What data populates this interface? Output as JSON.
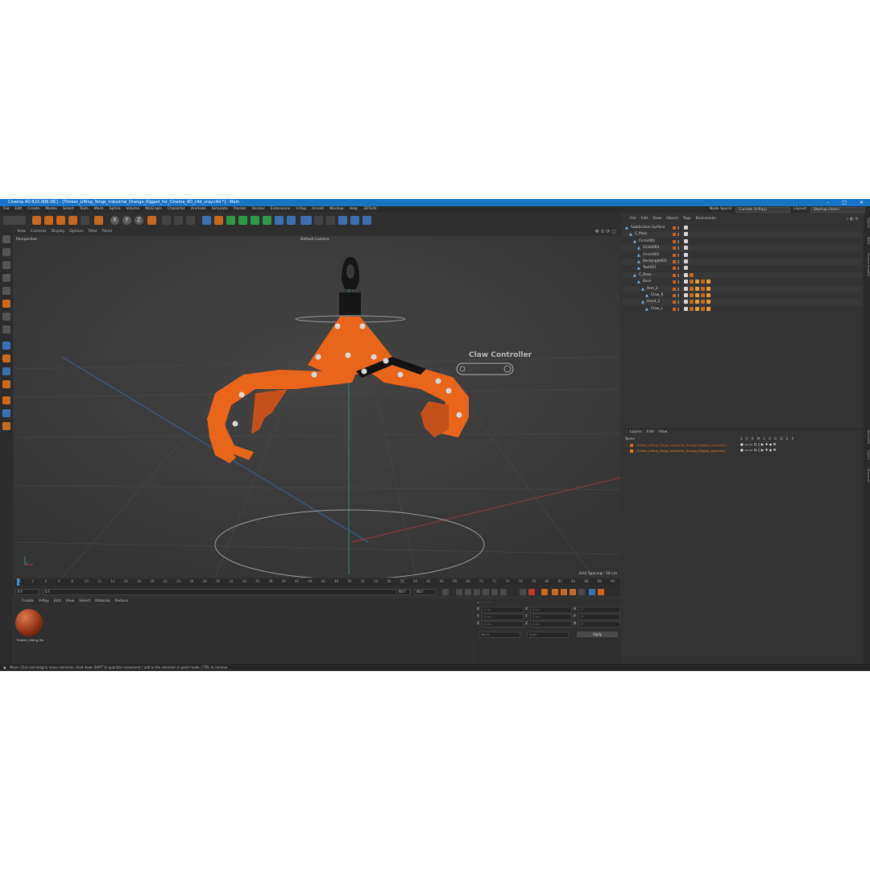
{
  "window": {
    "title": "Cinema 4D R23.008 (RC) - [Timber_Lifting_Tongs_Industrial_Orange_Rigged_for_Cinema_4D_c4d_vray.c4d *] - Main",
    "buttons": [
      "–",
      "□",
      "✕"
    ]
  },
  "menubar": {
    "items": [
      "File",
      "Edit",
      "Create",
      "Modes",
      "Select",
      "Tools",
      "Mesh",
      "Spline",
      "Volume",
      "MoGraph",
      "Character",
      "Animate",
      "Simulate",
      "Tracker",
      "Render",
      "Extensions",
      "V-Ray",
      "Arnold",
      "Window",
      "Help",
      "3DToAll"
    ],
    "node_space_label": "Node Space:",
    "node_space_value": "Current (V-Ray)",
    "layout_label": "Layout:",
    "layout_value": "Startup (User)"
  },
  "viewport": {
    "menu": [
      "View",
      "Cameras",
      "Display",
      "Options",
      "Filter",
      "Panel"
    ],
    "view_name": "Perspective",
    "camera": "Default Camera",
    "controller_label": "Claw Controller",
    "grid_spacing": "Grid Spacing : 50 cm"
  },
  "timeline": {
    "ticks": [
      "0",
      "2",
      "4",
      "6",
      "8",
      "10",
      "12",
      "14",
      "16",
      "18",
      "20",
      "22",
      "24",
      "26",
      "28",
      "30",
      "32",
      "34",
      "36",
      "38",
      "40",
      "42",
      "44",
      "46",
      "48",
      "50",
      "52",
      "54",
      "56",
      "58",
      "60",
      "62",
      "64",
      "66",
      "68",
      "70",
      "72",
      "74",
      "76",
      "78",
      "80",
      "82",
      "84",
      "86",
      "88",
      "90"
    ],
    "current_frame_field": "0 F",
    "start_field": "0 F",
    "end_field": "90 F",
    "end_field2": "90 F",
    "frame_display": "0 F"
  },
  "material_panel": {
    "menu": [
      "Create",
      "V-Ray",
      "Edit",
      "View",
      "Select",
      "Material",
      "Texture"
    ],
    "material_name": "Timber_Lifting_Ro"
  },
  "coordinates": {
    "rows": [
      {
        "axis": "X",
        "pos": "0 cm",
        "axis2": "X",
        "size": "0 cm",
        "axis3": "H",
        "rot": "0°"
      },
      {
        "axis": "Y",
        "pos": "0 cm",
        "axis2": "Y",
        "size": "0 cm",
        "axis3": "P",
        "rot": "0°"
      },
      {
        "axis": "Z",
        "pos": "0 cm",
        "axis2": "Z",
        "size": "0 cm",
        "axis3": "B",
        "rot": "0°"
      }
    ],
    "mode1": "World",
    "mode2": "Scale",
    "apply": "Apply"
  },
  "object_manager": {
    "menu": [
      "File",
      "Edit",
      "View",
      "Object",
      "Tags",
      "Bookmarks"
    ],
    "objects": [
      {
        "name": "Subdivision Surface",
        "indent": 0
      },
      {
        "name": "C_Main",
        "indent": 1
      },
      {
        "name": "Circle001",
        "indent": 2
      },
      {
        "name": "Circle003",
        "indent": 3
      },
      {
        "name": "Circle002",
        "indent": 3
      },
      {
        "name": "Rectangle001",
        "indent": 3
      },
      {
        "name": "Text001",
        "indent": 3
      },
      {
        "name": "C_Base",
        "indent": 2
      },
      {
        "name": "Base",
        "indent": 3
      },
      {
        "name": "Arm_2",
        "indent": 4
      },
      {
        "name": "Claw_R",
        "indent": 5
      },
      {
        "name": "Hand_1",
        "indent": 4
      },
      {
        "name": "Claw_L",
        "indent": 5
      }
    ]
  },
  "layer_manager": {
    "menu": [
      "Layers",
      "Edit",
      "View"
    ],
    "header": "Name",
    "columns": "S V R M L A G D E X",
    "layers": [
      {
        "name": "Timber_Lifting_Tongs_Industrial_Orange_Rigged_controllers",
        "color": "#d0601a"
      },
      {
        "name": "Timber_Lifting_Tongs_Industrial_Orange_Rigged_geometry",
        "color": "#e08020"
      }
    ]
  },
  "side_tabs": [
    "Objects",
    "Takes",
    "Content Browser",
    "Attributes",
    "Layers",
    "Structure"
  ],
  "statusbar": {
    "text": "Move: Click and drag to move elements. Hold down SHIFT to quantize movement / add to the selection in point mode, CTRL to remove."
  },
  "colors": {
    "accent_orange": "#e8651a",
    "titlebar_blue": "#1873c6"
  }
}
